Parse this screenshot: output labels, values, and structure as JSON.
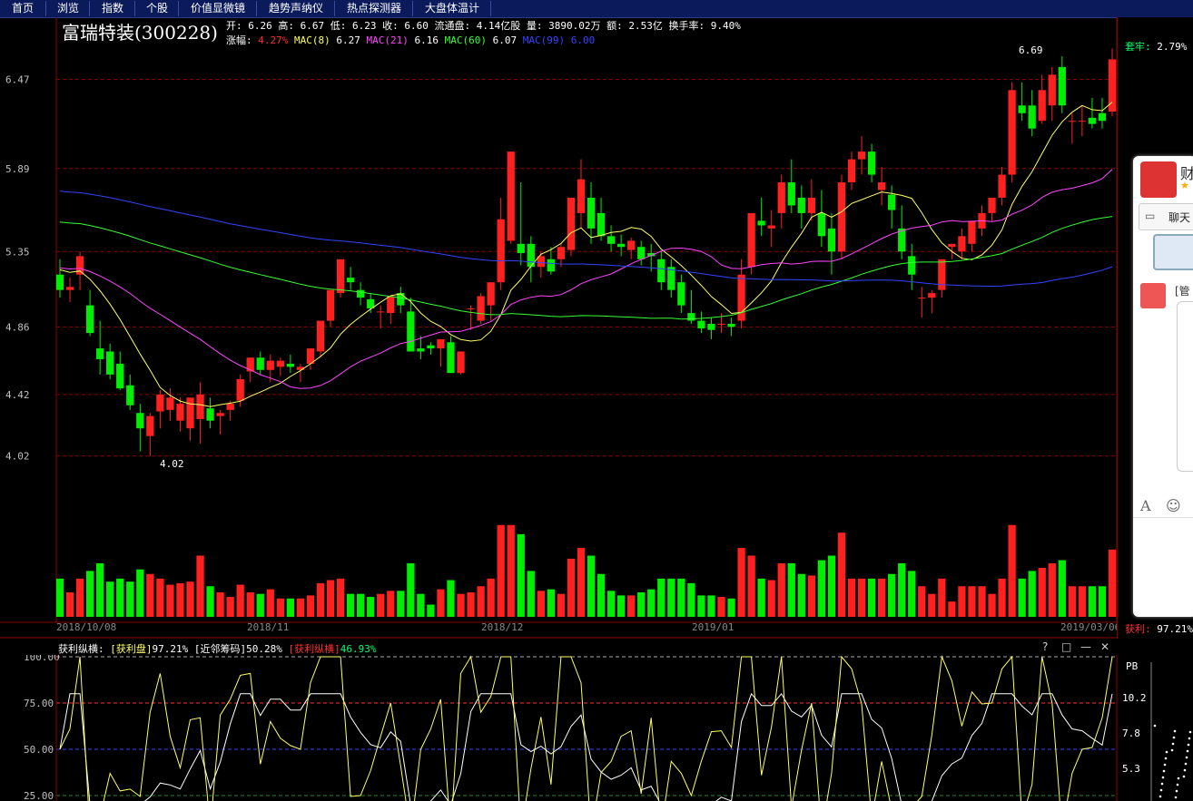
{
  "nav": {
    "tabs": [
      "首页",
      "浏览",
      "指数",
      "个股",
      "价值显微镜",
      "趋势声纳仪",
      "热点探测器",
      "大盘体温计"
    ]
  },
  "stock": {
    "name": "富瑞特装",
    "code": "(300228)",
    "open_label": "开:",
    "open": "6.26",
    "high_label": "高:",
    "high": "6.67",
    "low_label": "低:",
    "low": "6.23",
    "close_label": "收:",
    "close": "6.60",
    "float_label": "流通盘:",
    "float": "4.14亿股",
    "vol_label": "量:",
    "vol": "3890.02万",
    "amount_label": "额:",
    "amount": "2.53亿",
    "turnover_label": "换手率:",
    "turnover": "9.40%",
    "change_label": "涨幅:",
    "change": "4.27%",
    "mac8_label": "MAC(8)",
    "mac8": "6.27",
    "mac21_label": "MAC(21)",
    "mac21": "6.16",
    "mac60_label": "MAC(60)",
    "mac60": "6.07",
    "mac99_label": "MAC(99)",
    "mac99": "6.00"
  },
  "main_chart": {
    "price_ticks": [
      "6.47",
      "5.89",
      "5.35",
      "4.86",
      "4.42",
      "4.02"
    ],
    "high_mark": "6.69",
    "low_mark": "4.02",
    "date_ticks": [
      "2018/10/08",
      "2018/11",
      "2018/12",
      "2019/01",
      "2019/03/06"
    ]
  },
  "right_panel": {
    "taolao_label": "套牢:",
    "taolao_value": "2.79%",
    "huoli_label": "获利:",
    "huoli_value": "97.21%",
    "chat_label": "聊天",
    "chat_title_char": "财",
    "chat_note_char": "[管",
    "pb_label": "PB",
    "pb_ticks": [
      "10.2",
      "7.8",
      "5.3"
    ]
  },
  "indicator": {
    "name": "获利纵横:",
    "item1_label": "[获利盘]",
    "item1_value": "97.21%",
    "item2_label": "[近邻筹码]",
    "item2_value": "50.28%",
    "item3_label": "[获利纵横]",
    "item3_value": "46.93%",
    "y_ticks": [
      "100.00",
      "75.00",
      "50.00",
      "25.00"
    ],
    "controls": [
      "?",
      "□",
      "—",
      "✕"
    ]
  },
  "colors": {
    "up": "#ff2020",
    "down": "#00ee00",
    "ma8": "#ffff66",
    "ma21": "#ff44ff",
    "ma60": "#33ff33",
    "ma99": "#3344ff",
    "grid": "#8b0000"
  },
  "chart_data": {
    "type": "candlestick",
    "categories_first": "2018/10/08",
    "categories_last": "2019/03/06",
    "ohlc": [
      [
        5.2,
        5.3,
        5.05,
        5.1
      ],
      [
        5.1,
        5.18,
        5.02,
        5.12
      ],
      [
        5.2,
        5.35,
        5.1,
        5.32
      ],
      [
        5.0,
        5.1,
        4.8,
        4.82
      ],
      [
        4.72,
        4.9,
        4.55,
        4.65
      ],
      [
        4.7,
        4.75,
        4.52,
        4.55
      ],
      [
        4.62,
        4.7,
        4.45,
        4.46
      ],
      [
        4.48,
        4.55,
        4.32,
        4.35
      ],
      [
        4.3,
        4.36,
        4.05,
        4.2
      ],
      [
        4.15,
        4.3,
        4.02,
        4.28
      ],
      [
        4.31,
        4.45,
        4.2,
        4.42
      ],
      [
        4.32,
        4.46,
        4.25,
        4.4
      ],
      [
        4.25,
        4.4,
        4.18,
        4.36
      ],
      [
        4.2,
        4.35,
        4.12,
        4.4
      ],
      [
        4.26,
        4.5,
        4.1,
        4.42
      ],
      [
        4.33,
        4.4,
        4.2,
        4.25
      ],
      [
        4.28,
        4.32,
        4.16,
        4.3
      ],
      [
        4.32,
        4.38,
        4.25,
        4.36
      ],
      [
        4.38,
        4.55,
        4.34,
        4.52
      ],
      [
        4.57,
        4.66,
        4.5,
        4.66
      ],
      [
        4.66,
        4.7,
        4.55,
        4.58
      ],
      [
        4.58,
        4.68,
        4.5,
        4.64
      ],
      [
        4.6,
        4.66,
        4.54,
        4.64
      ],
      [
        4.62,
        4.68,
        4.56,
        4.6
      ],
      [
        4.58,
        4.62,
        4.5,
        4.6
      ],
      [
        4.62,
        4.72,
        4.58,
        4.72
      ],
      [
        4.7,
        4.88,
        4.66,
        4.9
      ],
      [
        4.9,
        5.1,
        4.86,
        5.1
      ],
      [
        5.08,
        5.3,
        5.05,
        5.3
      ],
      [
        5.18,
        5.25,
        5.1,
        5.15
      ],
      [
        5.1,
        5.15,
        5.0,
        5.05
      ],
      [
        5.04,
        5.08,
        4.95,
        4.98
      ],
      [
        4.96,
        5.0,
        4.85,
        4.96
      ],
      [
        4.95,
        5.05,
        4.88,
        5.06
      ],
      [
        5.08,
        5.12,
        4.95,
        5.0
      ],
      [
        4.96,
        5.05,
        4.7,
        4.7
      ],
      [
        4.72,
        4.8,
        4.65,
        4.7
      ],
      [
        4.74,
        4.76,
        4.68,
        4.72
      ],
      [
        4.72,
        4.78,
        4.6,
        4.78
      ],
      [
        4.76,
        4.8,
        4.56,
        4.56
      ],
      [
        4.56,
        4.7,
        4.55,
        4.7
      ],
      [
        4.98,
        5.0,
        4.84,
        4.98
      ],
      [
        4.9,
        5.08,
        4.88,
        5.06
      ],
      [
        5.0,
        5.15,
        4.9,
        5.15
      ],
      [
        5.15,
        5.7,
        5.1,
        5.56
      ],
      [
        5.42,
        6.0,
        5.4,
        6.0
      ],
      [
        5.4,
        5.8,
        5.26,
        5.34
      ],
      [
        5.4,
        5.45,
        5.15,
        5.25
      ],
      [
        5.25,
        5.35,
        5.18,
        5.32
      ],
      [
        5.3,
        5.38,
        5.2,
        5.22
      ],
      [
        5.3,
        5.4,
        5.25,
        5.38
      ],
      [
        5.36,
        5.7,
        5.32,
        5.7
      ],
      [
        5.6,
        5.95,
        5.5,
        5.82
      ],
      [
        5.7,
        5.8,
        5.4,
        5.5
      ],
      [
        5.6,
        5.7,
        5.42,
        5.45
      ],
      [
        5.45,
        5.52,
        5.35,
        5.4
      ],
      [
        5.4,
        5.46,
        5.32,
        5.38
      ],
      [
        5.36,
        5.44,
        5.3,
        5.42
      ],
      [
        5.38,
        5.42,
        5.26,
        5.3
      ],
      [
        5.34,
        5.4,
        5.22,
        5.32
      ],
      [
        5.3,
        5.35,
        5.1,
        5.15
      ],
      [
        5.25,
        5.3,
        5.05,
        5.1
      ],
      [
        5.15,
        5.2,
        4.95,
        5.0
      ],
      [
        4.95,
        5.1,
        4.88,
        4.9
      ],
      [
        4.9,
        4.96,
        4.82,
        4.85
      ],
      [
        4.88,
        4.92,
        4.78,
        4.84
      ],
      [
        4.88,
        4.95,
        4.82,
        4.88
      ],
      [
        4.88,
        4.92,
        4.8,
        4.86
      ],
      [
        4.9,
        5.3,
        4.85,
        5.2
      ],
      [
        5.25,
        5.6,
        5.2,
        5.6
      ],
      [
        5.55,
        5.7,
        5.45,
        5.52
      ],
      [
        5.5,
        5.62,
        5.38,
        5.52
      ],
      [
        5.6,
        5.85,
        5.5,
        5.8
      ],
      [
        5.8,
        5.95,
        5.6,
        5.65
      ],
      [
        5.7,
        5.78,
        5.5,
        5.6
      ],
      [
        5.6,
        5.82,
        5.55,
        5.7
      ],
      [
        5.6,
        5.75,
        5.38,
        5.45
      ],
      [
        5.5,
        5.6,
        5.2,
        5.35
      ],
      [
        5.35,
        5.85,
        5.3,
        5.8
      ],
      [
        5.8,
        6.0,
        5.75,
        5.95
      ],
      [
        5.95,
        6.1,
        5.85,
        6.0
      ],
      [
        6.0,
        6.05,
        5.8,
        5.85
      ],
      [
        5.75,
        5.9,
        5.65,
        5.8
      ],
      [
        5.72,
        5.78,
        5.5,
        5.62
      ],
      [
        5.5,
        5.65,
        5.3,
        5.35
      ],
      [
        5.32,
        5.4,
        5.1,
        5.2
      ],
      [
        5.05,
        5.12,
        4.92,
        5.05
      ],
      [
        5.05,
        5.1,
        4.95,
        5.08
      ],
      [
        5.1,
        5.3,
        5.05,
        5.3
      ],
      [
        5.38,
        5.4,
        5.3,
        5.4
      ],
      [
        5.35,
        5.5,
        5.3,
        5.45
      ],
      [
        5.4,
        5.55,
        5.35,
        5.55
      ],
      [
        5.5,
        5.65,
        5.45,
        5.6
      ],
      [
        5.6,
        5.7,
        5.55,
        5.7
      ],
      [
        5.7,
        5.9,
        5.65,
        5.85
      ],
      [
        5.85,
        6.45,
        5.8,
        6.4
      ],
      [
        6.3,
        6.45,
        6.2,
        6.25
      ],
      [
        6.3,
        6.4,
        6.1,
        6.15
      ],
      [
        6.2,
        6.5,
        6.18,
        6.4
      ],
      [
        6.3,
        6.55,
        6.2,
        6.5
      ],
      [
        6.55,
        6.62,
        6.25,
        6.3
      ],
      [
        6.2,
        6.25,
        6.05,
        6.2
      ],
      [
        6.2,
        6.3,
        6.1,
        6.2
      ],
      [
        6.22,
        6.35,
        6.15,
        6.18
      ],
      [
        6.25,
        6.35,
        6.15,
        6.2
      ],
      [
        6.26,
        6.67,
        6.23,
        6.6
      ]
    ],
    "ylim": [
      3.8,
      6.75
    ]
  }
}
